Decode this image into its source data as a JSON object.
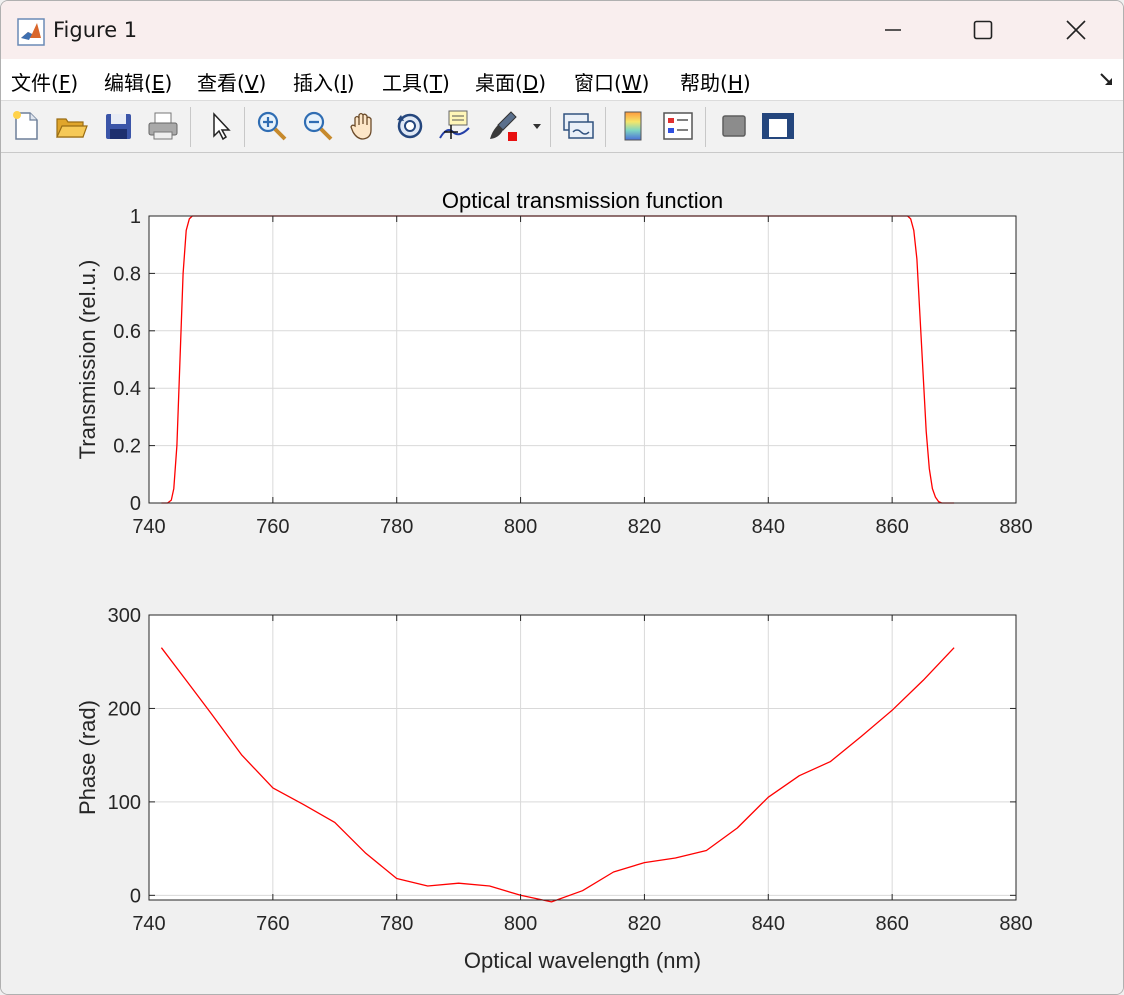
{
  "window": {
    "title": "Figure 1",
    "controls": {
      "minimize": "minimize",
      "maximize": "maximize",
      "close": "close"
    }
  },
  "menu": [
    {
      "label": "文件(F)",
      "text": "文件(",
      "key": "F"
    },
    {
      "label": "编辑(E)",
      "text": "编辑(",
      "key": "E"
    },
    {
      "label": "查看(V)",
      "text": "查看(",
      "key": "V"
    },
    {
      "label": "插入(I)",
      "text": "插入(",
      "key": "I"
    },
    {
      "label": "工具(T)",
      "text": "工具(",
      "key": "T"
    },
    {
      "label": "桌面(D)",
      "text": "桌面(",
      "key": "D"
    },
    {
      "label": "窗口(W)",
      "text": "窗口(",
      "key": "W"
    },
    {
      "label": "帮助(H)",
      "text": "帮助(",
      "key": "H"
    }
  ],
  "toolbar": {
    "buttons": [
      "new-figure-icon",
      "open-file-icon",
      "save-icon",
      "print-icon",
      "pointer-icon",
      "zoom-in-icon",
      "zoom-out-icon",
      "pan-hand-icon",
      "rotate-3d-icon",
      "data-cursor-icon",
      "brush-icon",
      "brush-dropdown-icon",
      "link-plot-icon",
      "colorbar-icon",
      "legend-icon",
      "hide-plot-tools-icon",
      "show-plot-tools-icon"
    ]
  },
  "colors": {
    "line": "#ff0000",
    "grid": "#d9d9d9",
    "axes_bg": "#ffffff",
    "figure_bg": "#f0f0f0"
  },
  "chart_data": [
    {
      "type": "line",
      "title": "Optical transmission function",
      "xlabel": "",
      "ylabel": "Transmission (rel.u.)",
      "xlim": [
        740,
        880
      ],
      "ylim": [
        0,
        1
      ],
      "xticks": [
        "740",
        "760",
        "780",
        "800",
        "820",
        "840",
        "860",
        "880"
      ],
      "yticks": [
        "0",
        "0.2",
        "0.4",
        "0.6",
        "0.8",
        "1"
      ],
      "grid": true,
      "series": [
        {
          "x": [
            742,
            743,
            743.6,
            744,
            744.5,
            745,
            745.5,
            746,
            746.5,
            747,
            750,
            800,
            860,
            862,
            862.5,
            863,
            863.5,
            864,
            864.5,
            865,
            865.5,
            866,
            866.5,
            867,
            867.5,
            868,
            869,
            870
          ],
          "y": [
            0,
            0,
            0.01,
            0.05,
            0.2,
            0.5,
            0.8,
            0.95,
            0.99,
            1,
            1,
            1,
            1,
            1,
            1,
            0.99,
            0.95,
            0.85,
            0.65,
            0.45,
            0.25,
            0.12,
            0.05,
            0.02,
            0.005,
            0,
            0,
            0
          ]
        }
      ]
    },
    {
      "type": "line",
      "title": "",
      "xlabel": "Optical wavelength (nm)",
      "ylabel": "Phase (rad)",
      "xlim": [
        740,
        880
      ],
      "ylim": [
        -5,
        300
      ],
      "xticks": [
        "740",
        "760",
        "780",
        "800",
        "820",
        "840",
        "860",
        "880"
      ],
      "yticks": [
        "0",
        "100",
        "200",
        "300"
      ],
      "grid": true,
      "series": [
        {
          "x": [
            742,
            746,
            750,
            755,
            760,
            765,
            770,
            775,
            780,
            785,
            790,
            795,
            800,
            805,
            810,
            815,
            820,
            825,
            830,
            835,
            840,
            845,
            850,
            855,
            860,
            865,
            870
          ],
          "y": [
            265,
            230,
            195,
            150,
            115,
            97,
            78,
            45,
            18,
            10,
            13,
            10,
            0,
            -7,
            5,
            25,
            35,
            40,
            48,
            72,
            105,
            128,
            143,
            170,
            198,
            230,
            265
          ]
        }
      ]
    }
  ]
}
